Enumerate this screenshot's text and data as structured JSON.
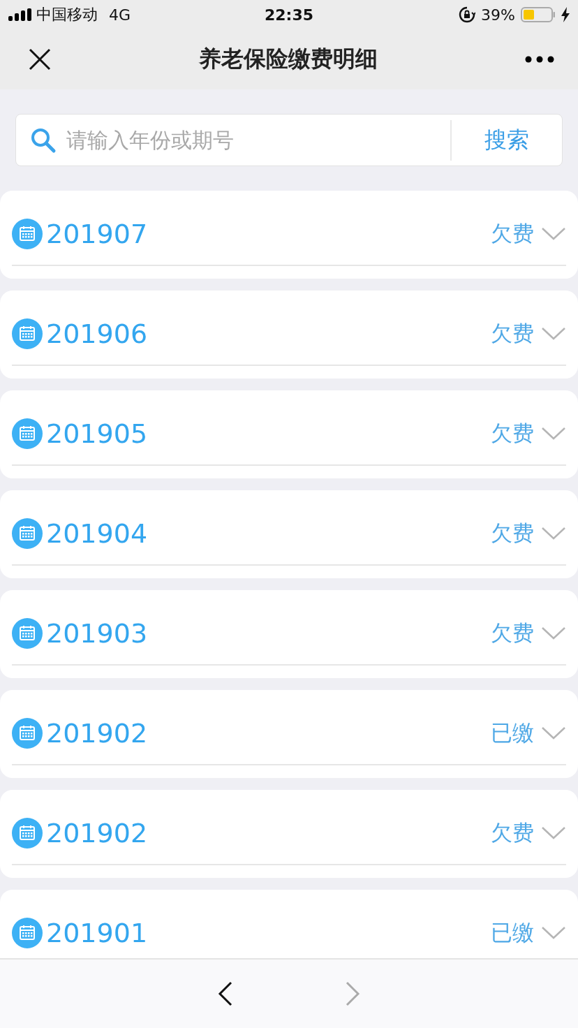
{
  "status_bar": {
    "carrier": "中国移动",
    "network": "4G",
    "time": "22:35",
    "battery": "39%"
  },
  "nav_bar": {
    "title": "养老保险缴费明细"
  },
  "search": {
    "placeholder": "请输入年份或期号",
    "button": "搜索"
  },
  "periods": [
    {
      "period": "201907",
      "status": "欠费",
      "expanded": false
    },
    {
      "period": "201906",
      "status": "欠费",
      "expanded": false
    },
    {
      "period": "201905",
      "status": "欠费",
      "expanded": false
    },
    {
      "period": "201904",
      "status": "欠费",
      "expanded": false
    },
    {
      "period": "201903",
      "status": "欠费",
      "expanded": false
    },
    {
      "period": "201902",
      "status": "已缴",
      "expanded": false
    },
    {
      "period": "201902",
      "status": "欠费",
      "expanded": false
    },
    {
      "period": "201901",
      "status": "已缴",
      "expanded": false
    }
  ],
  "toolbar": {
    "back_disabled": false,
    "forward_disabled": true
  }
}
